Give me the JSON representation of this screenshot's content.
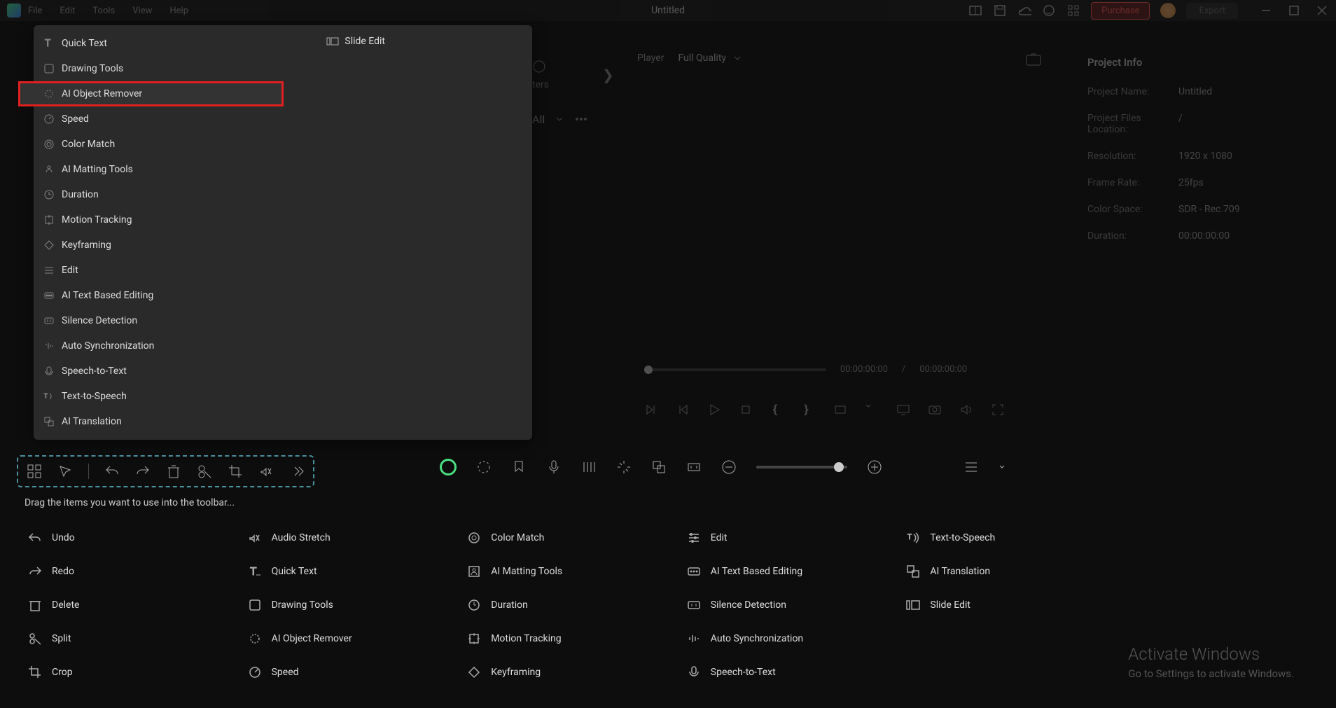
{
  "titlebar": {
    "menus": [
      "Wondershare Filmora",
      "File",
      "Edit",
      "Tools",
      "View",
      "Help"
    ],
    "title": "Untitled",
    "purchase": "Purchase",
    "export": "Export"
  },
  "dropdown": {
    "items": [
      {
        "label": "Quick Text",
        "icon": "text"
      },
      {
        "label": "Drawing Tools",
        "icon": "draw"
      },
      {
        "label": "AI Object Remover",
        "icon": "remove",
        "highlighted": true
      },
      {
        "label": "Speed",
        "icon": "speed"
      },
      {
        "label": "Color Match",
        "icon": "color"
      },
      {
        "label": "AI Matting Tools",
        "icon": "matting"
      },
      {
        "label": "Duration",
        "icon": "duration"
      },
      {
        "label": "Motion Tracking",
        "icon": "tracking"
      },
      {
        "label": "Keyframing",
        "icon": "keyframe"
      },
      {
        "label": "Edit",
        "icon": "edit"
      },
      {
        "label": "AI Text Based Editing",
        "icon": "aitext"
      },
      {
        "label": "Silence Detection",
        "icon": "silence"
      },
      {
        "label": "Auto Synchronization",
        "icon": "sync"
      },
      {
        "label": "Speech-to-Text",
        "icon": "stt"
      },
      {
        "label": "Text-to-Speech",
        "icon": "tts"
      },
      {
        "label": "AI Translation",
        "icon": "translate"
      }
    ],
    "slide_edit": "Slide Edit"
  },
  "project_info": {
    "title": "Project Info",
    "name_label": "Project Name:",
    "name_value": "Untitled",
    "files_label": "Project Files Location:",
    "files_value": "/",
    "resolution_label": "Resolution:",
    "resolution_value": "1920 x 1080",
    "framerate_label": "Frame Rate:",
    "framerate_value": "25fps",
    "colorspace_label": "Color Space:",
    "colorspace_value": "SDR - Rec.709",
    "duration_label": "Duration:",
    "duration_value": "00:00:00:00"
  },
  "player": {
    "label": "Player",
    "quality": "Full Quality",
    "current_time": "00:00:00:00",
    "divider": "/",
    "total_time": "00:00:00:00"
  },
  "hidden": {
    "tabs_text": "ters",
    "all": "All",
    "arrow": "❯"
  },
  "toolbar_customize": {
    "hint": "Drag the items you want to use into the toolbar...",
    "items": [
      {
        "label": "Undo",
        "icon": "undo"
      },
      {
        "label": "Audio Stretch",
        "icon": "stretch"
      },
      {
        "label": "Color Match",
        "icon": "color"
      },
      {
        "label": "Edit",
        "icon": "edit"
      },
      {
        "label": "Text-to-Speech",
        "icon": "tts"
      },
      {
        "label": "Redo",
        "icon": "redo"
      },
      {
        "label": "Quick Text",
        "icon": "text"
      },
      {
        "label": "AI Matting Tools",
        "icon": "matting"
      },
      {
        "label": "AI Text Based Editing",
        "icon": "aitext"
      },
      {
        "label": "AI Translation",
        "icon": "translate"
      },
      {
        "label": "Delete",
        "icon": "delete"
      },
      {
        "label": "Drawing Tools",
        "icon": "draw"
      },
      {
        "label": "Duration",
        "icon": "duration"
      },
      {
        "label": "Silence Detection",
        "icon": "silence"
      },
      {
        "label": "Slide Edit",
        "icon": "slide"
      },
      {
        "label": "Split",
        "icon": "split"
      },
      {
        "label": "AI Object Remover",
        "icon": "remove"
      },
      {
        "label": "Motion Tracking",
        "icon": "tracking"
      },
      {
        "label": "Auto Synchronization",
        "icon": "sync"
      },
      {
        "label": "",
        "icon": ""
      },
      {
        "label": "Crop",
        "icon": "crop"
      },
      {
        "label": "Speed",
        "icon": "speed"
      },
      {
        "label": "Keyframing",
        "icon": "keyframe"
      },
      {
        "label": "Speech-to-Text",
        "icon": "stt"
      }
    ]
  },
  "watermark": {
    "title": "Activate Windows",
    "sub": "Go to Settings to activate Windows."
  }
}
